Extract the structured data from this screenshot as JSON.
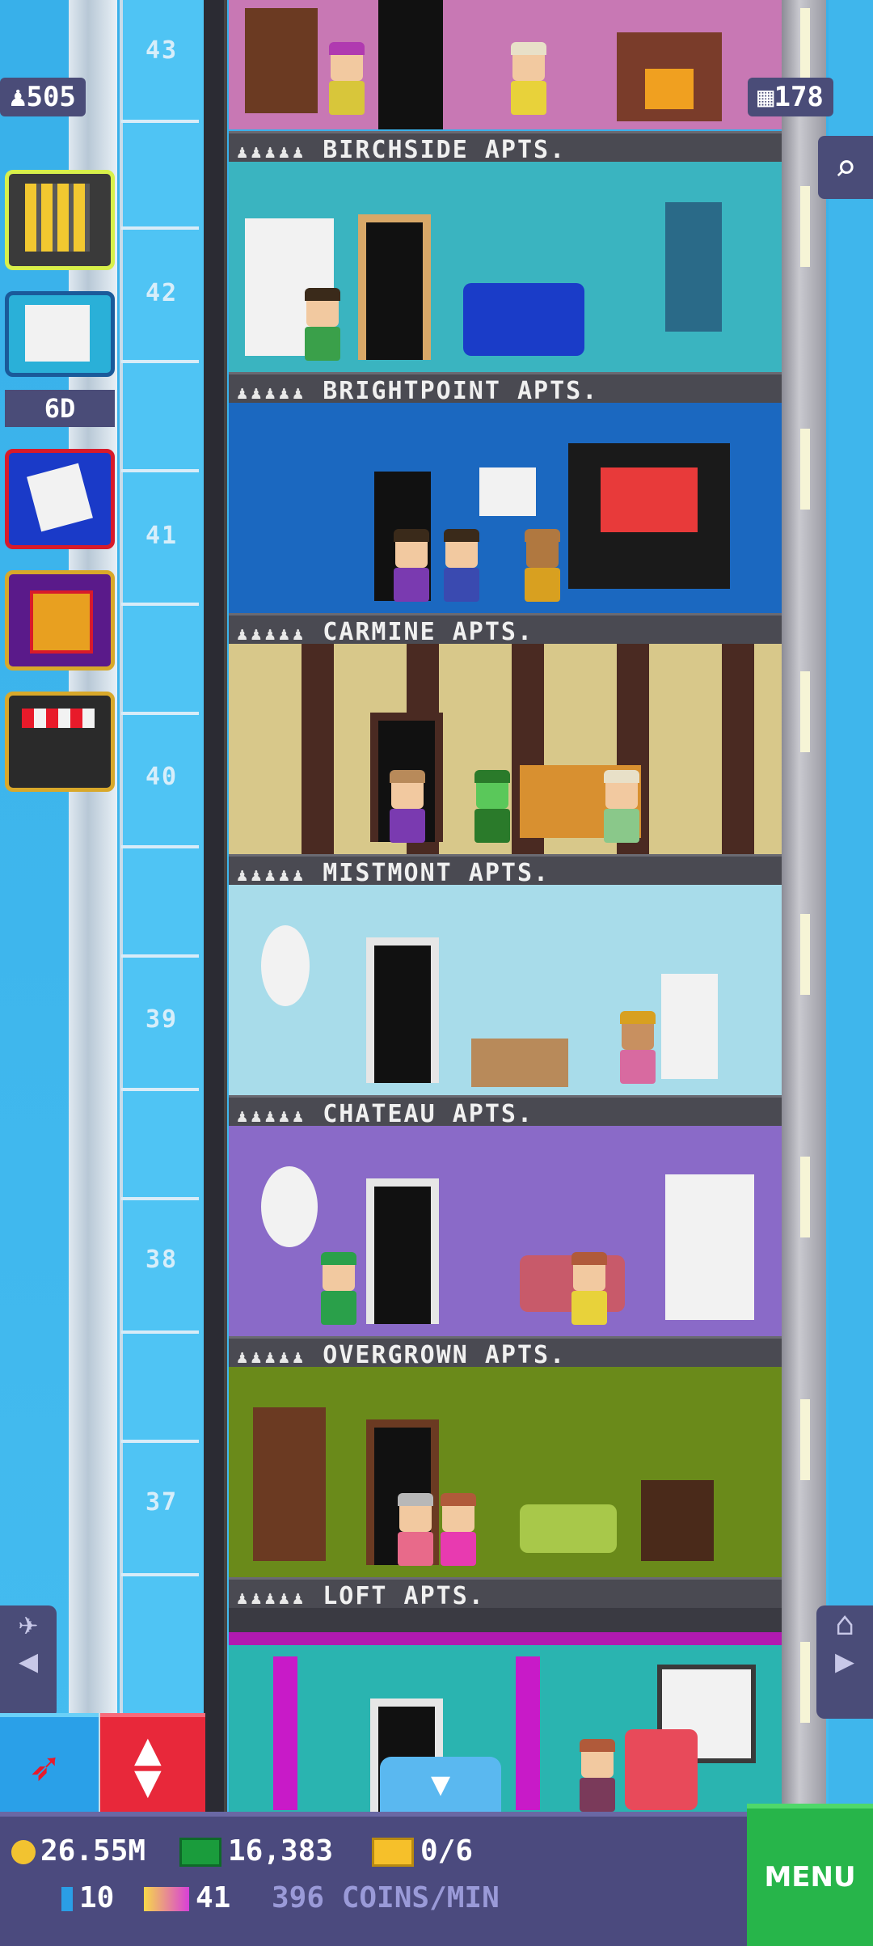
{
  "hud": {
    "residents": "505",
    "floors": "178",
    "event_timer": "6D"
  },
  "floors": [
    {
      "label": "BIRCHSIDE APTS.",
      "number": "43"
    },
    {
      "label": "BRIGHTPOINT APTS.",
      "number": "42"
    },
    {
      "label": "CARMINE APTS.",
      "number": "41"
    },
    {
      "label": "MISTMONT APTS.",
      "number": "40"
    },
    {
      "label": "CHATEAU APTS.",
      "number": "39"
    },
    {
      "label": "OVERGROWN APTS.",
      "number": "38"
    },
    {
      "label": "LOFT APTS.",
      "number": "37"
    }
  ],
  "bottom_bar": {
    "coins": "26.55M",
    "bux": "16,383",
    "tickets": "0/6",
    "elevator_tickets": "10",
    "vip_tickets": "41",
    "rate": "396 COINS/MIN",
    "menu": "MENU"
  },
  "colors": {
    "menu": "#27b54a",
    "hud_panel": "#4b4a7e",
    "sky": "#3fb3ea"
  }
}
